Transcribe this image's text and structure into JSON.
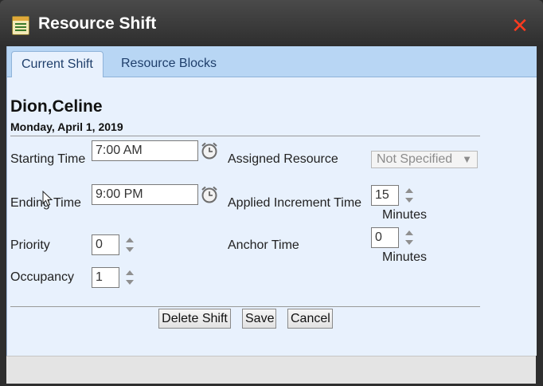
{
  "window": {
    "title": "Resource Shift",
    "icon": "notepad-icon",
    "close_icon": "close-icon",
    "accent_close_color": "#ff3b1f"
  },
  "tabs": [
    {
      "label": "Current Shift",
      "active": true
    },
    {
      "label": "Resource Blocks",
      "active": false
    }
  ],
  "resource": {
    "name": "Dion,Celine",
    "date": "Monday, April 1, 2019"
  },
  "form": {
    "starting_time": {
      "label": "Starting Time",
      "value": "7:00 AM",
      "icon": "alarm-clock-icon"
    },
    "ending_time": {
      "label": "Ending Time",
      "value": "9:00 PM",
      "icon": "alarm-clock-icon"
    },
    "priority": {
      "label": "Priority",
      "value": "0"
    },
    "occupancy": {
      "label": "Occupancy",
      "value": "1"
    },
    "assigned_resource": {
      "label": "Assigned Resource",
      "value": "Not Specified"
    },
    "applied_increment_time": {
      "label": "Applied Increment Time",
      "value": "15",
      "unit": "Minutes"
    },
    "anchor_time": {
      "label": "Anchor Time",
      "value": "0",
      "unit": "Minutes"
    }
  },
  "buttons": {
    "delete": "Delete Shift",
    "save": "Save",
    "cancel": "Cancel"
  }
}
